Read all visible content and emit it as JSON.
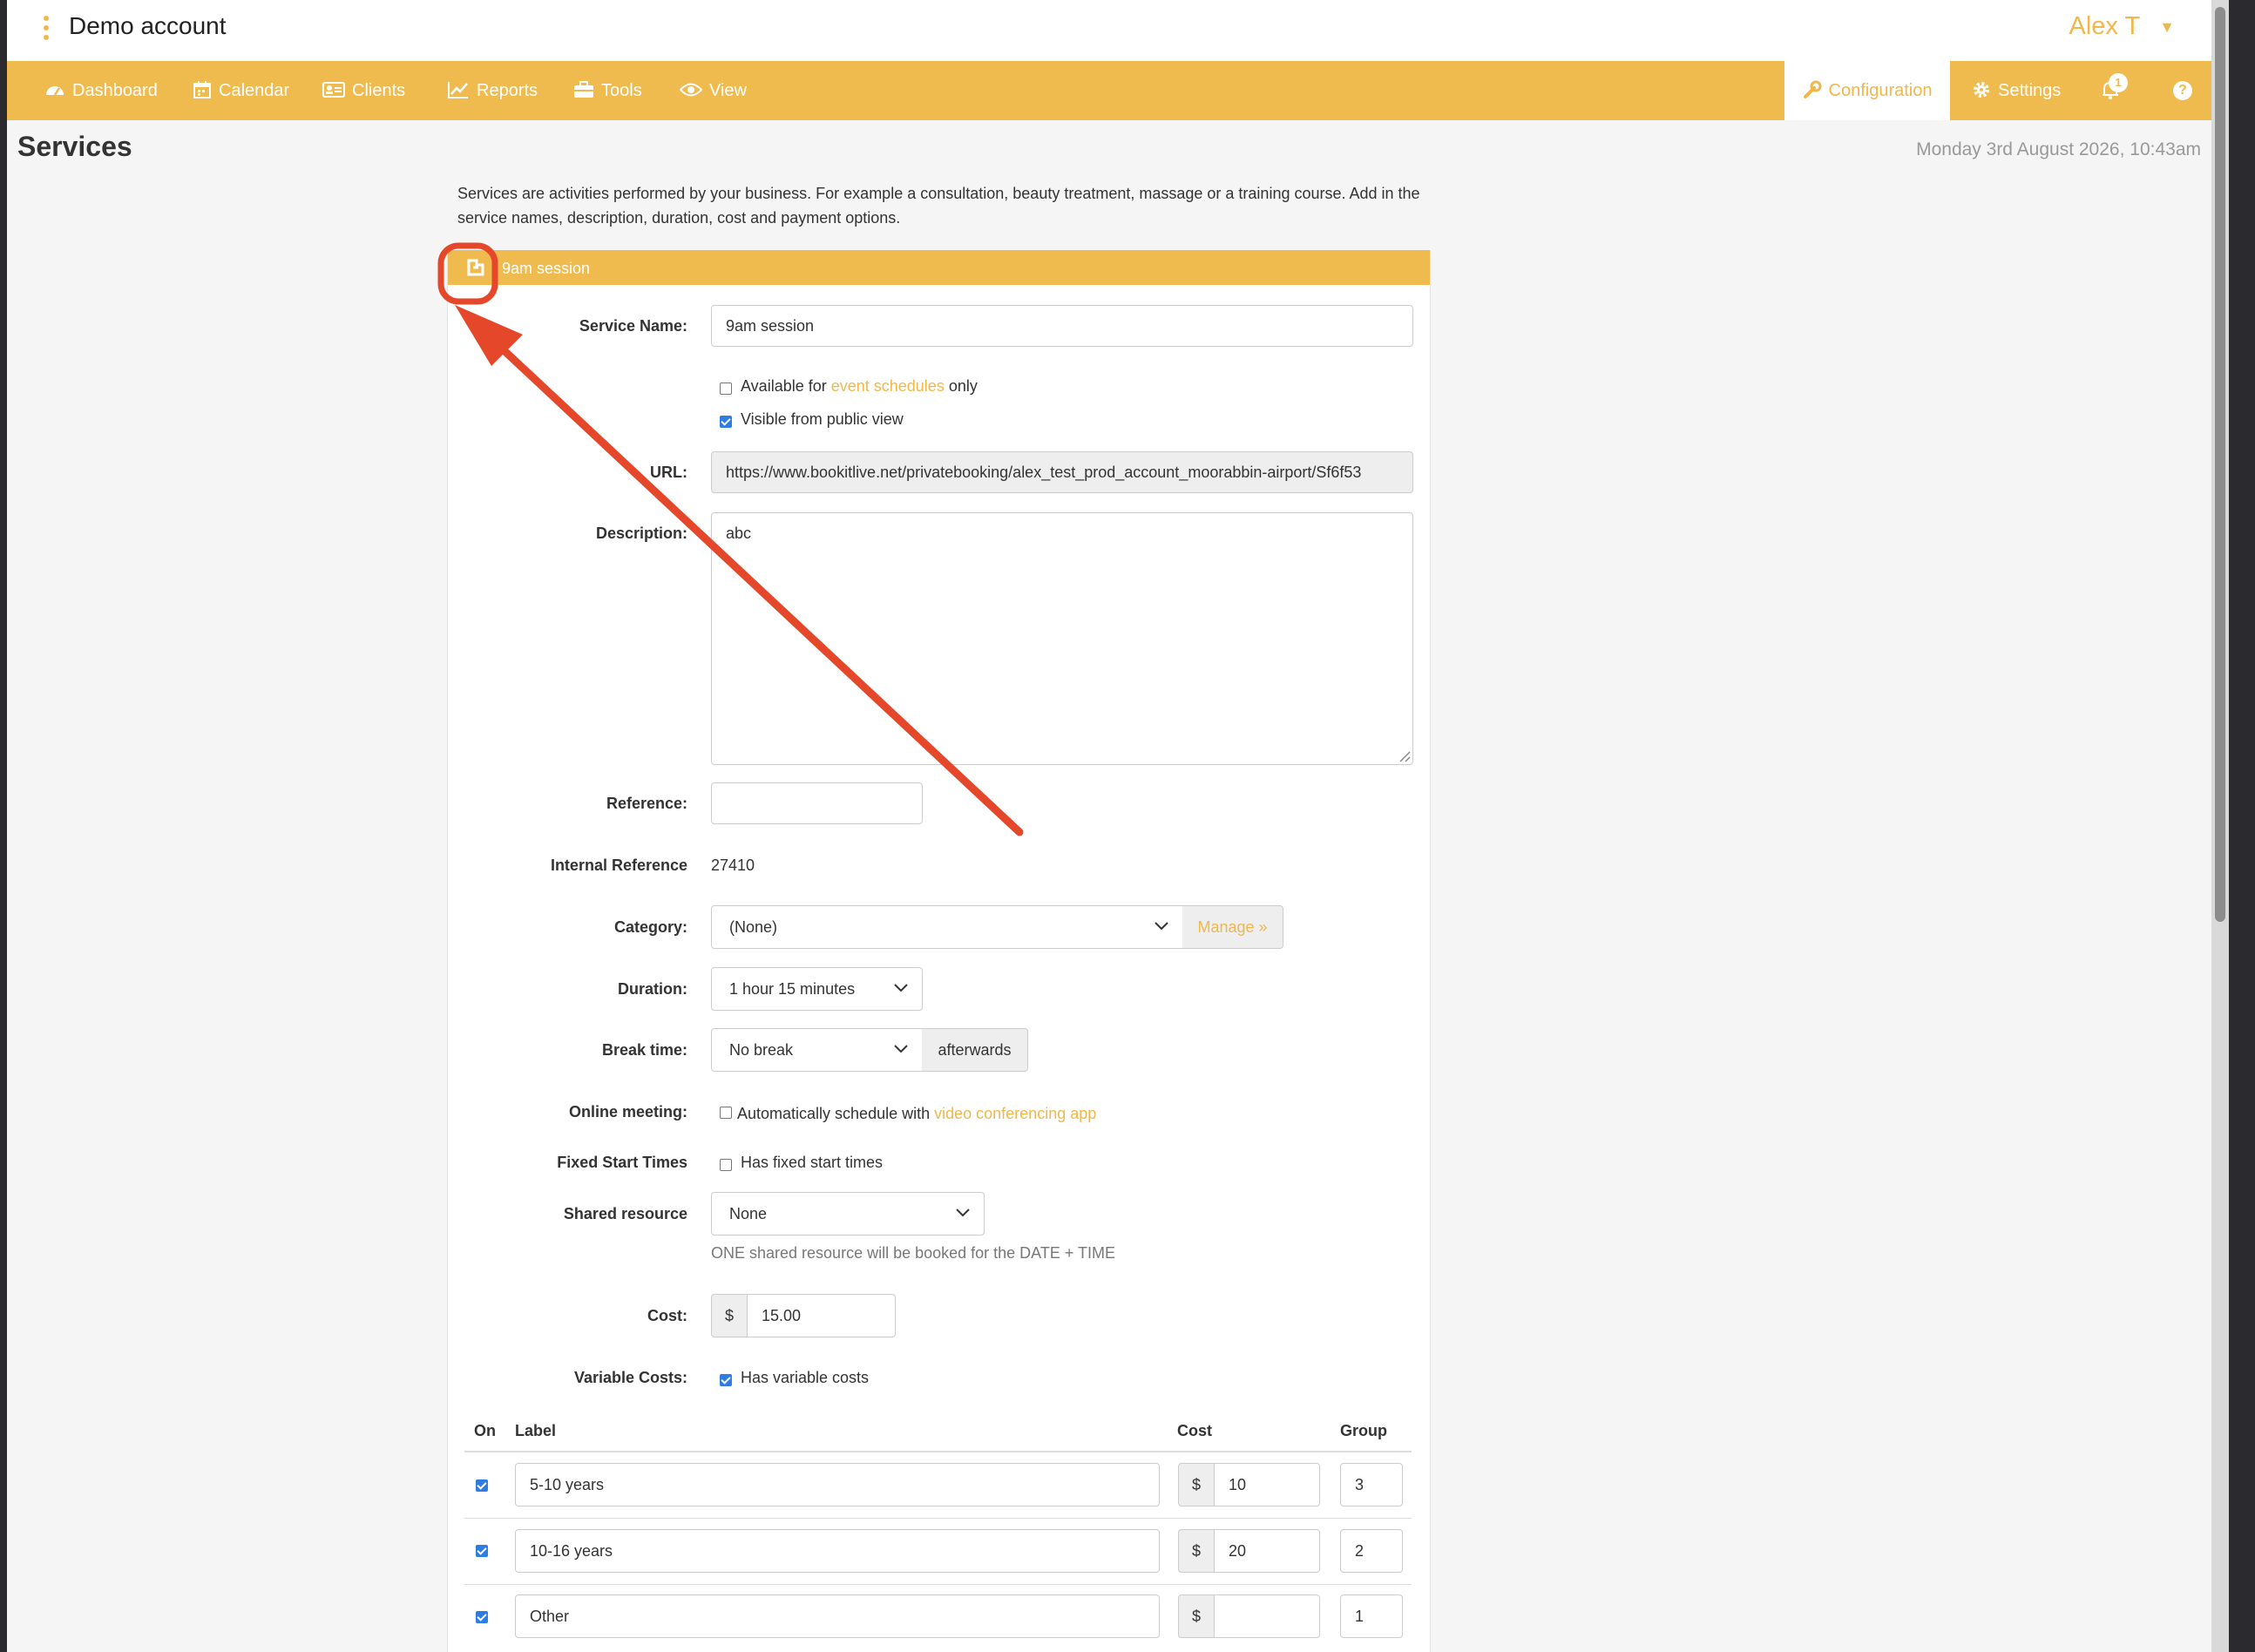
{
  "header": {
    "account_name": "Demo account",
    "user_name": "Alex T",
    "user_caret": "▼"
  },
  "nav": {
    "items": [
      {
        "label": "Dashboard",
        "icon": "dashboard-icon"
      },
      {
        "label": "Calendar",
        "icon": "calendar-icon"
      },
      {
        "label": "Clients",
        "icon": "clients-icon"
      },
      {
        "label": "Reports",
        "icon": "chart-line-icon"
      },
      {
        "label": "Tools",
        "icon": "briefcase-icon"
      },
      {
        "label": "View",
        "icon": "eye-icon"
      }
    ],
    "configuration": "Configuration",
    "settings": "Settings",
    "notifications_count": "1",
    "help": "?"
  },
  "page": {
    "title": "Services",
    "datetime": "Monday 3rd August 2026, 10:43am",
    "intro": "Services are activities performed by your business. For example a consultation, beauty treatment, massage or a training course. Add in the service names, description, duration, cost and payment options."
  },
  "panel": {
    "title": "9am session"
  },
  "form": {
    "service_name_label": "Service Name:",
    "service_name": "9am session",
    "event_prefix": "Available for ",
    "event_link": "event schedules",
    "event_suffix": " only",
    "event_only_checked": false,
    "visible_label": "Visible from public view",
    "visible_checked": true,
    "url_label": "URL:",
    "url": "https://www.bookitlive.net/privatebooking/alex_test_prod_account_moorabbin-airport/Sf6f53",
    "description_label": "Description:",
    "description": "abc",
    "reference_label": "Reference:",
    "reference": "",
    "internal_ref_label": "Internal Reference",
    "internal_ref": "27410",
    "category_label": "Category:",
    "category": "(None)",
    "manage": "Manage »",
    "duration_label": "Duration:",
    "duration": "1 hour 15 minutes",
    "break_label": "Break time:",
    "break_value": "No break",
    "break_suffix": "afterwards",
    "online_label": "Online meeting:",
    "online_prefix": "Automatically schedule with ",
    "online_link": "video conferencing app",
    "online_checked": false,
    "fixed_label": "Fixed Start Times",
    "fixed_text": "Has fixed start times",
    "fixed_checked": false,
    "shared_label": "Shared resource",
    "shared_value": "None",
    "shared_help": "ONE shared resource will be booked for the DATE + TIME",
    "cost_label": "Cost:",
    "currency": "$",
    "cost": "15.00",
    "variable_label": "Variable Costs:",
    "variable_text": "Has variable costs",
    "variable_checked": true
  },
  "variable_costs": {
    "headers": {
      "on": "On",
      "label": "Label",
      "cost": "Cost",
      "group": "Group"
    },
    "rows": [
      {
        "on": true,
        "label": "5-10 years",
        "currency": "$",
        "cost": "10",
        "group": "3"
      },
      {
        "on": true,
        "label": "10-16 years",
        "currency": "$",
        "cost": "20",
        "group": "2"
      },
      {
        "on": true,
        "label": "Other",
        "currency": "$",
        "cost": "",
        "group": "1"
      }
    ]
  },
  "colors": {
    "brand": "#f0bb4e",
    "link": "#f0b74a",
    "checkbox": "#2f7de1",
    "annotation": "#e5472b"
  }
}
